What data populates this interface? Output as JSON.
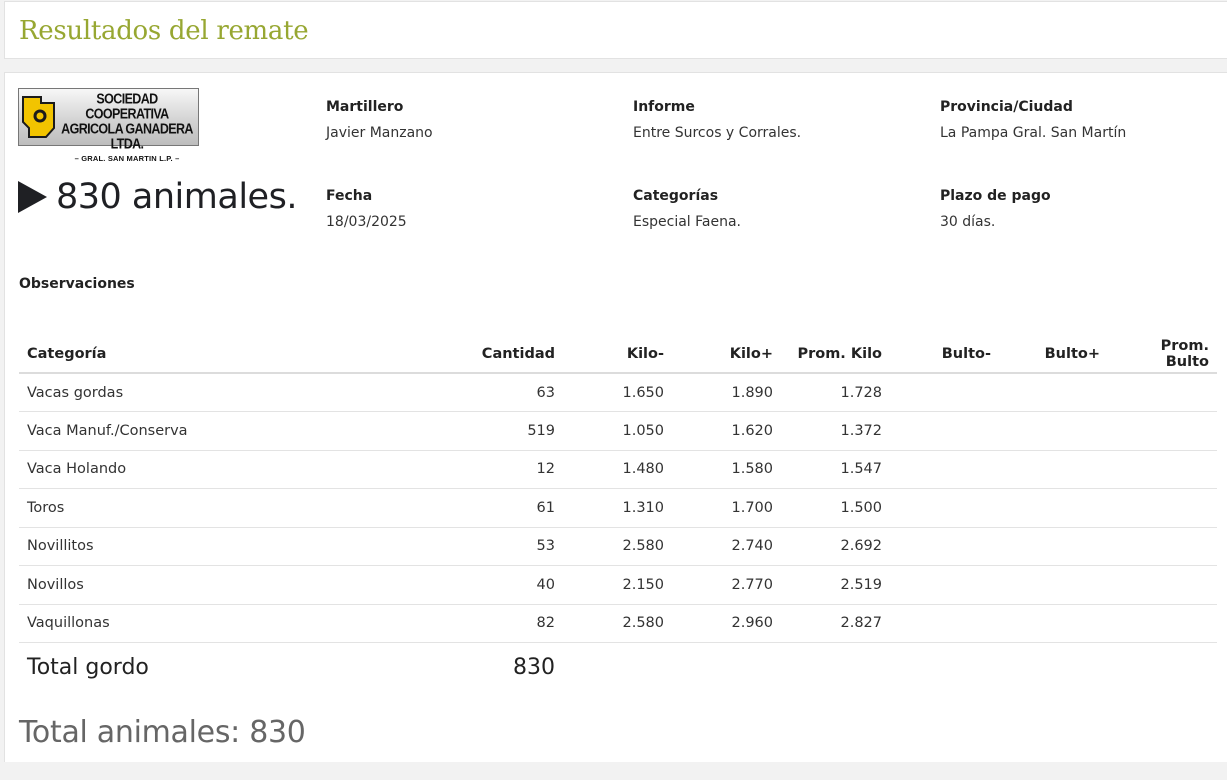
{
  "page": {
    "title": "Resultados del remate"
  },
  "logo": {
    "line1": "SOCIEDAD COOPERATIVA",
    "line2": "AGRICOLA GANADERA LTDA.",
    "line3": "– GRAL. SAN MARTIN L.P. –"
  },
  "summary": {
    "animals_text": "830 animales."
  },
  "info": {
    "martillero_label": "Martillero",
    "martillero_value": "Javier Manzano",
    "informe_label": "Informe",
    "informe_value": "Entre Surcos y Corrales.",
    "provincia_label": "Provincia/Ciudad",
    "provincia_value": "La Pampa Gral. San Martín",
    "fecha_label": "Fecha",
    "fecha_value": "18/03/2025",
    "categorias_label": "Categorías",
    "categorias_value": "Especial Faena.",
    "plazo_label": "Plazo de pago",
    "plazo_value": "30 días.",
    "observaciones_label": "Observaciones"
  },
  "table": {
    "headers": [
      "Categoría",
      "Cantidad",
      "Kilo-",
      "Kilo+",
      "Prom. Kilo",
      "Bulto-",
      "Bulto+",
      "Prom. Bulto"
    ],
    "rows": [
      [
        "Vacas gordas",
        "63",
        "1.650",
        "1.890",
        "1.728",
        "",
        "",
        ""
      ],
      [
        "Vaca Manuf./Conserva",
        "519",
        "1.050",
        "1.620",
        "1.372",
        "",
        "",
        ""
      ],
      [
        "Vaca Holando",
        "12",
        "1.480",
        "1.580",
        "1.547",
        "",
        "",
        ""
      ],
      [
        "Toros",
        "61",
        "1.310",
        "1.700",
        "1.500",
        "",
        "",
        ""
      ],
      [
        "Novillitos",
        "53",
        "2.580",
        "2.740",
        "2.692",
        "",
        "",
        ""
      ],
      [
        "Novillos",
        "40",
        "2.150",
        "2.770",
        "2.519",
        "",
        "",
        ""
      ],
      [
        "Vaquillonas",
        "82",
        "2.580",
        "2.960",
        "2.827",
        "",
        "",
        ""
      ]
    ],
    "total_label": "Total gordo",
    "total_value": "830"
  },
  "footer": {
    "total_animales": "Total animales: 830"
  }
}
